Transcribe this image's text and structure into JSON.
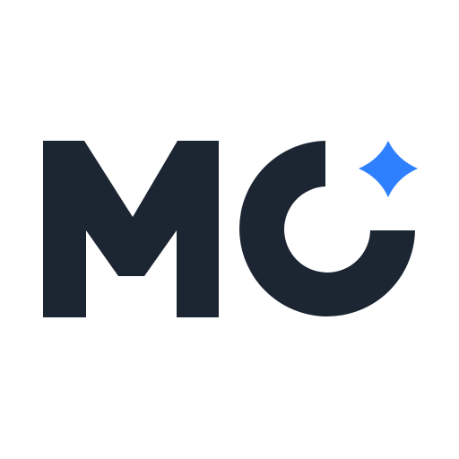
{
  "logo": {
    "text": "MC",
    "colors": {
      "background": "#ffffff",
      "letters": "#1c2532",
      "sparkle": "#2f80ff"
    },
    "icons": [
      "sparkle-icon"
    ]
  }
}
